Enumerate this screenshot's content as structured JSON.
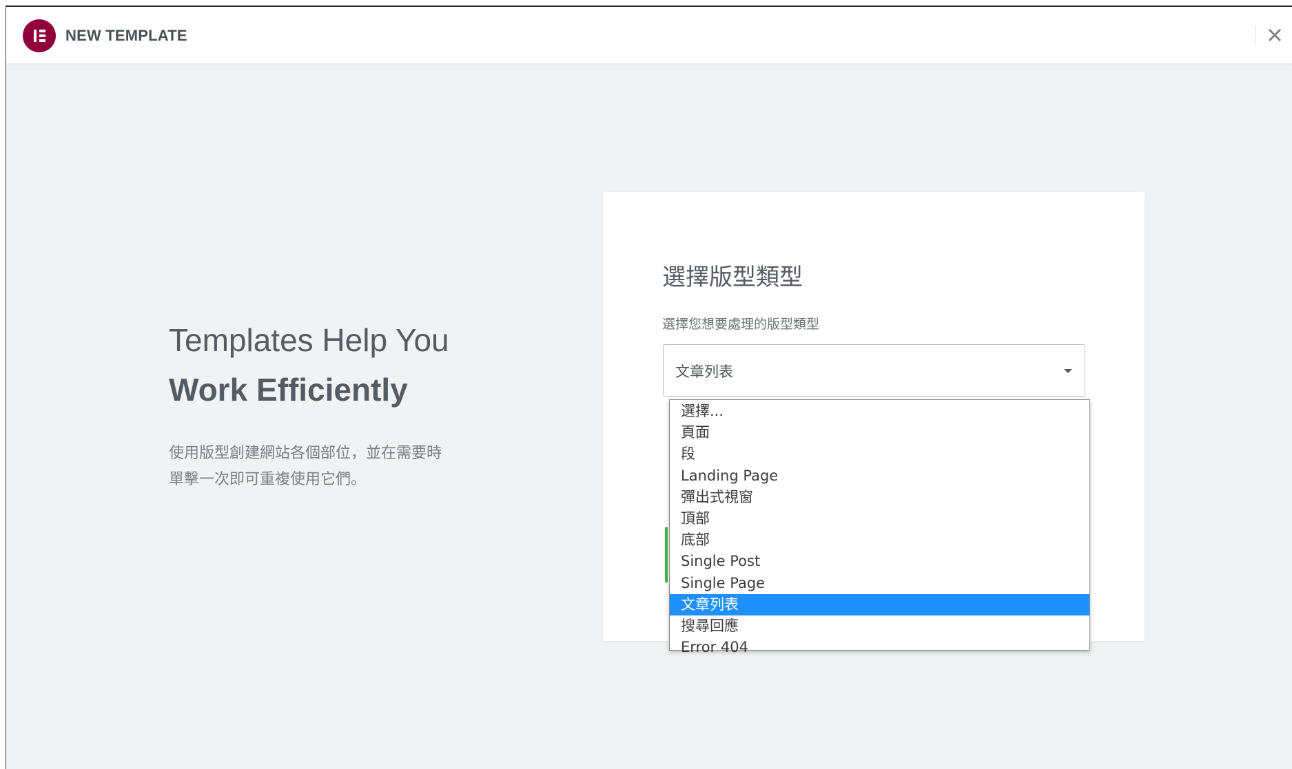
{
  "header": {
    "title": "NEW TEMPLATE"
  },
  "colors": {
    "brand": "#92003b",
    "selection": "#1e90ff",
    "accent_green": "#39b54a"
  },
  "intro": {
    "title_line1": "Templates Help You",
    "title_line2": "Work Efficiently",
    "description_line1": "使用版型創建網站各個部位，並在需要時",
    "description_line2": "單擊一次即可重複使用它們。"
  },
  "form": {
    "title": "選擇版型類型",
    "label": "選擇您想要處理的版型類型",
    "selected_value": "文章列表",
    "options": [
      "選擇...",
      "頁面",
      "段",
      "Landing Page",
      "彈出式視窗",
      "頂部",
      "底部",
      "Single Post",
      "Single Page",
      "文章列表",
      "搜尋回應",
      "Error 404"
    ],
    "selected_index": 9
  }
}
